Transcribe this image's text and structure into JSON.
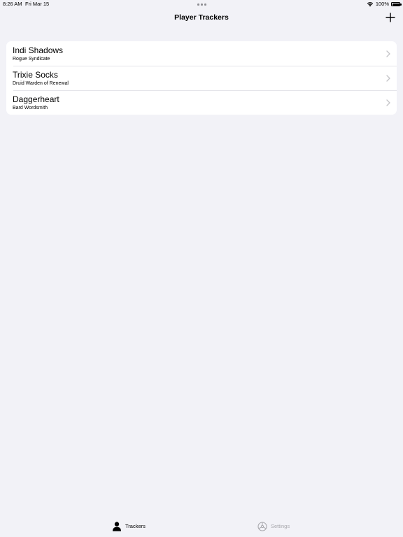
{
  "status_bar": {
    "time": "8:26 AM",
    "date": "Fri Mar 15",
    "battery": "100%"
  },
  "nav": {
    "title": "Player Trackers",
    "add_icon": "plus-icon"
  },
  "trackers": [
    {
      "name": "Indi Shadows",
      "subtitle": "Rogue Syndicate"
    },
    {
      "name": "Trixie Socks",
      "subtitle": "Druid Warden of Renewal"
    },
    {
      "name": "Daggerheart",
      "subtitle": "Bard Wordsmith"
    }
  ],
  "tab_bar": {
    "tabs": [
      {
        "label": "Trackers",
        "icon": "person-icon",
        "selected": true
      },
      {
        "label": "Settings",
        "icon": "gear-icon",
        "selected": false
      }
    ]
  },
  "colors": {
    "background": "#f2f2f7",
    "card": "#ffffff",
    "separator": "#e5e5ea",
    "chevron": "#c4c4c7",
    "inactive_tab": "#a8a8ad",
    "active_tab": "#000000"
  }
}
